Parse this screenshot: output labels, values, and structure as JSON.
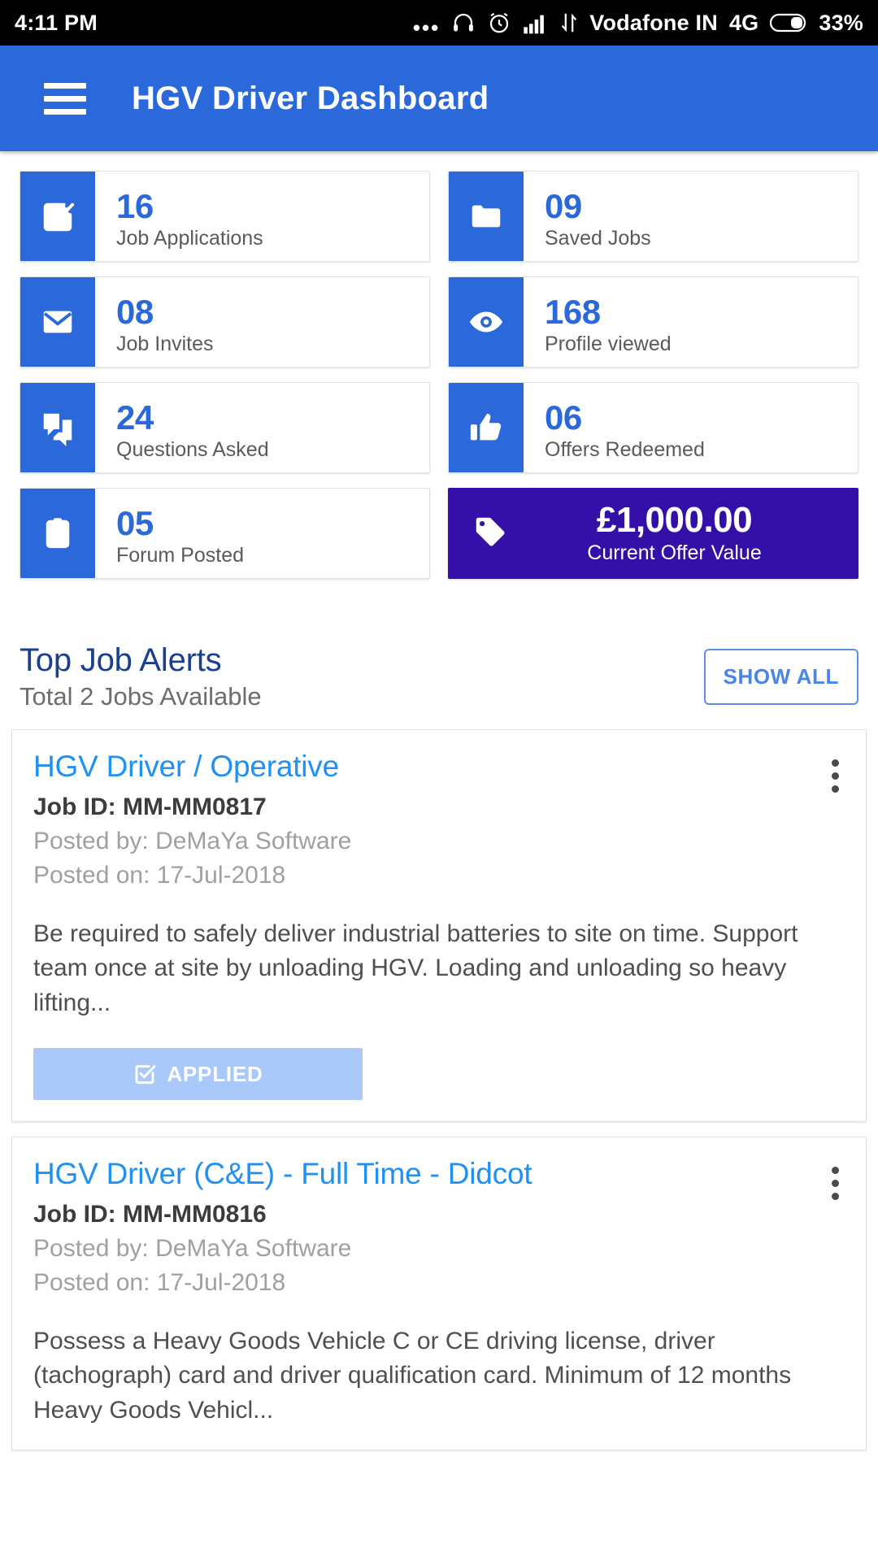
{
  "status_bar": {
    "time": "4:11 PM",
    "icons": [
      "more-dots-icon",
      "headphones-icon",
      "alarm-clock-icon",
      "signal-bars-icon",
      "data-transfer-icon"
    ],
    "carrier": "Vodafone IN",
    "network": "4G",
    "battery_icon": "battery-icon",
    "battery_percent": "33%"
  },
  "app_bar": {
    "menu_icon": "hamburger-menu-icon",
    "title": "HGV Driver Dashboard",
    "background_color": "#2b68d9"
  },
  "stats": [
    {
      "value": "16",
      "label": "Job Applications",
      "icon": "checkbox-checked-icon"
    },
    {
      "value": "09",
      "label": "Saved Jobs",
      "icon": "folder-icon"
    },
    {
      "value": "08",
      "label": "Job Invites",
      "icon": "envelope-icon"
    },
    {
      "value": "168",
      "label": "Profile viewed",
      "icon": "eye-icon"
    },
    {
      "value": "24",
      "label": "Questions Asked",
      "icon": "chat-bubbles-icon"
    },
    {
      "value": "06",
      "label": "Offers Redeemed",
      "icon": "thumbs-up-icon"
    },
    {
      "value": "05",
      "label": "Forum Posted",
      "icon": "clipboard-icon"
    }
  ],
  "offer_card": {
    "icon": "price-tag-icon",
    "amount": "£1,000.00",
    "caption": "Current Offer Value",
    "background_color": "#3510a8"
  },
  "alerts_section": {
    "title": "Top Job Alerts",
    "subtitle": "Total 2 Jobs Available",
    "show_all_label": "SHOW ALL"
  },
  "jobs": [
    {
      "title": "HGV Driver / Operative",
      "job_id": "Job ID: MM-MM0817",
      "posted_by": "Posted by: DeMaYa Software",
      "posted_on": "Posted on: 17-Jul-2018",
      "description": "Be required to safely deliver industrial batteries to site on time. Support team once at site by unloading HGV. Loading and unloading so heavy lifting...",
      "action_label": "APPLIED",
      "action_icon": "checkbox-checked-icon",
      "menu_icon": "kebab-menu-icon"
    },
    {
      "title": "HGV Driver (C&E) - Full Time - Didcot",
      "job_id": "Job ID: MM-MM0816",
      "posted_by": "Posted by: DeMaYa Software",
      "posted_on": "Posted on: 17-Jul-2018",
      "description": "Possess a Heavy Goods Vehicle C or CE driving license, driver (tachograph) card and driver qualification card. Minimum of 12 months Heavy Goods Vehicl...",
      "menu_icon": "kebab-menu-icon"
    }
  ],
  "colors": {
    "primary_blue": "#2b68d9",
    "link_blue": "#2091f2",
    "purple": "#3510a8",
    "applied_blue": "#a9c9fa",
    "heading_navy": "#1a3f8f"
  }
}
